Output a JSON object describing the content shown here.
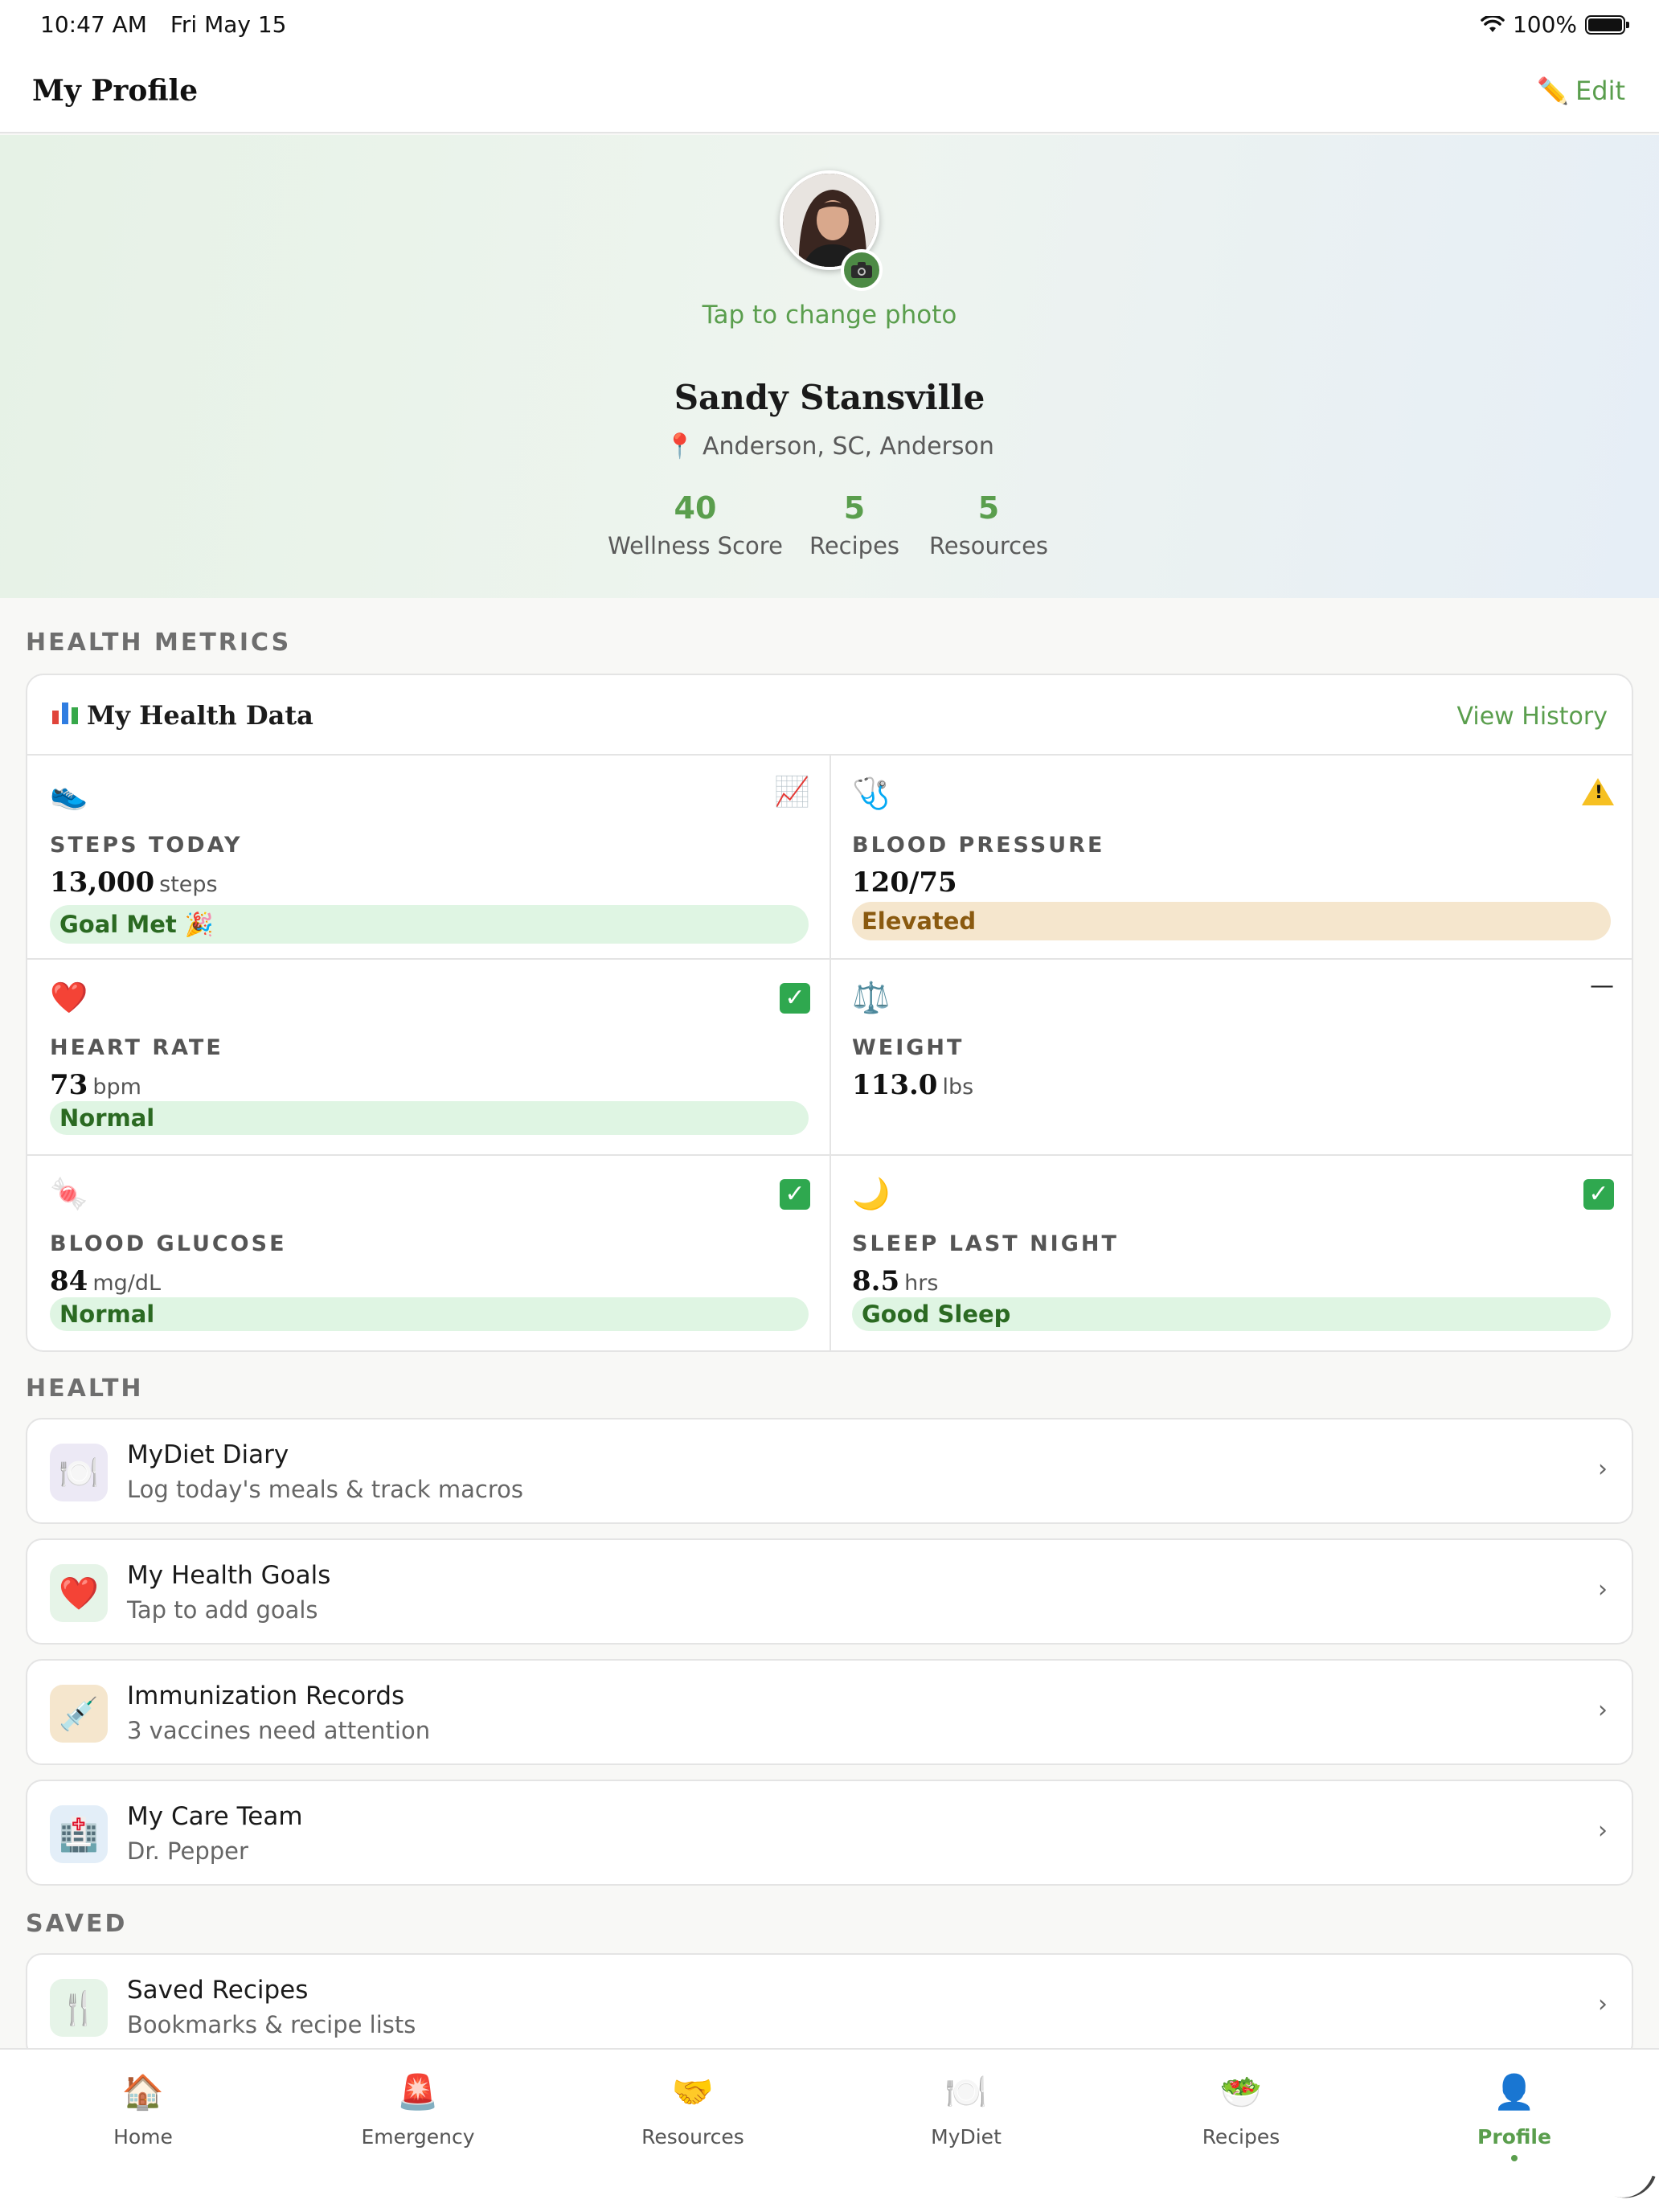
{
  "status_bar": {
    "time": "10:47 AM",
    "date": "Fri May 15",
    "battery": "100%"
  },
  "nav": {
    "title": "My Profile",
    "edit_label": "Edit",
    "edit_icon": "pencil-icon"
  },
  "profile": {
    "change_photo": "Tap to change photo",
    "name": "Sandy Stansville",
    "location": "Anderson, SC, Anderson",
    "stats": [
      {
        "value": "40",
        "label": "Wellness Score"
      },
      {
        "value": "5",
        "label": "Recipes"
      },
      {
        "value": "5",
        "label": "Resources"
      }
    ]
  },
  "health_metrics": {
    "section_title": "HEALTH METRICS",
    "card_title": "My Health Data",
    "view_history": "View History",
    "metrics": [
      {
        "icon": "sneaker-icon",
        "glyph": "👟",
        "flag_icon": "trend-up-icon",
        "flag": "📈",
        "label": "STEPS TODAY",
        "value": "13,000",
        "unit": "steps",
        "status": "Goal Met 🎉",
        "status_color": "green",
        "status_level": "good"
      },
      {
        "icon": "stethoscope-icon",
        "glyph": "🩺",
        "flag_icon": "warning-icon",
        "label": "BLOOD PRESSURE",
        "value": "120/75",
        "unit": "",
        "status": "Elevated",
        "status_color": "amber",
        "status_level": "warn"
      },
      {
        "icon": "heart-icon",
        "glyph": "❤️",
        "flag_icon": "check-icon",
        "label": "HEART RATE",
        "value": "73",
        "unit": "bpm",
        "status": "Normal",
        "status_color": "green",
        "status_level": "good"
      },
      {
        "icon": "scale-icon",
        "glyph": "⚖️",
        "flag_icon": "dash-icon",
        "flag": "—",
        "label": "WEIGHT",
        "value": "113.0",
        "unit": "lbs",
        "status": "",
        "status_color": "",
        "status_level": "none"
      },
      {
        "icon": "candy-icon",
        "glyph": "🍬",
        "flag_icon": "check-icon",
        "label": "BLOOD GLUCOSE",
        "value": "84",
        "unit": "mg/dL",
        "status": "Normal",
        "status_color": "green",
        "status_level": "good"
      },
      {
        "icon": "moon-icon",
        "glyph": "🌙",
        "flag_icon": "check-icon",
        "label": "SLEEP LAST NIGHT",
        "value": "8.5",
        "unit": "hrs",
        "status": "Good Sleep",
        "status_color": "green",
        "status_level": "good"
      }
    ]
  },
  "health": {
    "section_title": "HEALTH",
    "items": [
      {
        "icon": "plate-icon",
        "glyph": "🍽️",
        "bg": "#ece9f5",
        "title": "MyDiet Diary",
        "subtitle": "Log today's meals & track macros"
      },
      {
        "icon": "heart-icon",
        "glyph": "❤️",
        "bg": "#e6f4e8",
        "title": "My Health Goals",
        "subtitle": "Tap to add goals"
      },
      {
        "icon": "syringe-icon",
        "glyph": "💉",
        "bg": "#f5e6cd",
        "title": "Immunization Records",
        "subtitle": "3 vaccines need attention"
      },
      {
        "icon": "hospital-icon",
        "glyph": "🏥",
        "bg": "#e3eef8",
        "title": "My Care Team",
        "subtitle": "Dr. Pepper"
      }
    ]
  },
  "saved": {
    "section_title": "SAVED",
    "items": [
      {
        "icon": "fork-knife-icon",
        "glyph": "🍴",
        "bg": "#e6f4e8",
        "title": "Saved Recipes",
        "subtitle": "Bookmarks & recipe lists"
      }
    ]
  },
  "tabs": [
    {
      "label": "Home",
      "icon": "house-icon",
      "glyph": "🏠",
      "active": false
    },
    {
      "label": "Emergency",
      "icon": "siren-icon",
      "glyph": "🚨",
      "active": false
    },
    {
      "label": "Resources",
      "icon": "handshake-icon",
      "glyph": "🤝",
      "active": false
    },
    {
      "label": "MyDiet",
      "icon": "plate-icon",
      "glyph": "🍽️",
      "active": false
    },
    {
      "label": "Recipes",
      "icon": "salad-icon",
      "glyph": "🥗",
      "active": false
    },
    {
      "label": "Profile",
      "icon": "person-icon",
      "glyph": "👤",
      "active": true
    }
  ],
  "colors": {
    "accent": "#5a9e4d",
    "pill_green": "#dff5e3",
    "pill_amber": "#f5e6cd"
  }
}
